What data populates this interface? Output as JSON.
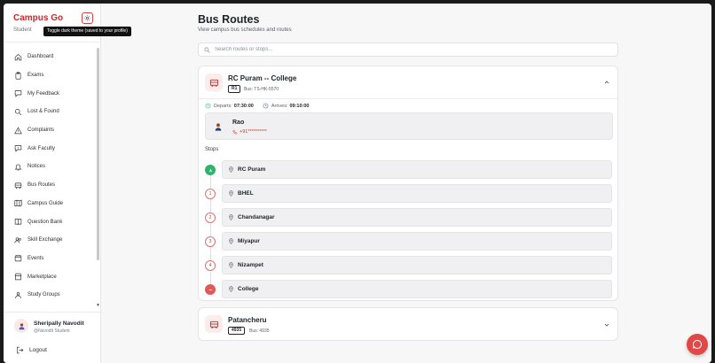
{
  "app": {
    "title": "Campus Go",
    "role": "Student"
  },
  "theme_toggle": {
    "tooltip": "Toggle dark theme (saved to your profile)"
  },
  "sidebar": {
    "items": [
      {
        "label": "Dashboard",
        "icon": "home-icon"
      },
      {
        "label": "Exams",
        "icon": "clipboard-icon"
      },
      {
        "label": "My Feedback",
        "icon": "message-icon"
      },
      {
        "label": "Lost & Found",
        "icon": "search-icon"
      },
      {
        "label": "Complaints",
        "icon": "alert-icon"
      },
      {
        "label": "Ask Faculty",
        "icon": "help-icon"
      },
      {
        "label": "Notices",
        "icon": "bell-icon"
      },
      {
        "label": "Bus Routes",
        "icon": "bus-icon"
      },
      {
        "label": "Campus Guide",
        "icon": "map-icon"
      },
      {
        "label": "Question Bank",
        "icon": "book-icon"
      },
      {
        "label": "Skill Exchange",
        "icon": "users-icon"
      },
      {
        "label": "Events",
        "icon": "calendar-icon"
      },
      {
        "label": "Marketplace",
        "icon": "shop-icon"
      },
      {
        "label": "Study Groups",
        "icon": "group-icon"
      }
    ]
  },
  "user": {
    "name": "Sheripally Navodit",
    "sub": "@Navodit Student"
  },
  "logout_label": "Logout",
  "page": {
    "title": "Bus Routes",
    "subtitle": "View campus bus schedules and routes"
  },
  "search": {
    "placeholder": "Search routes or stops..."
  },
  "routes": [
    {
      "name": "RC Puram -- College",
      "code": "R1",
      "bus": "Bus: TS-HK-5570",
      "departs_label": "Departs:",
      "departs": "07:30:00",
      "arrives_label": "Arrives:",
      "arrives": "09:10:00",
      "driver_name": "Rao",
      "driver_phone": "+91**********",
      "stops_label": "Stops",
      "stops": [
        {
          "marker": "",
          "name": "RC Puram"
        },
        {
          "marker": "1",
          "name": "BHEL"
        },
        {
          "marker": "2",
          "name": "Chandanagar"
        },
        {
          "marker": "3",
          "name": "Miyapur"
        },
        {
          "marker": "4",
          "name": "Nizampet"
        },
        {
          "marker": "",
          "name": "College"
        }
      ]
    },
    {
      "name": "Patancheru",
      "code": "4935",
      "bus": "Bus: 4935"
    }
  ],
  "colors": {
    "accent": "#c62b2b",
    "start": "#2fb36b",
    "end": "#e05a5a"
  }
}
